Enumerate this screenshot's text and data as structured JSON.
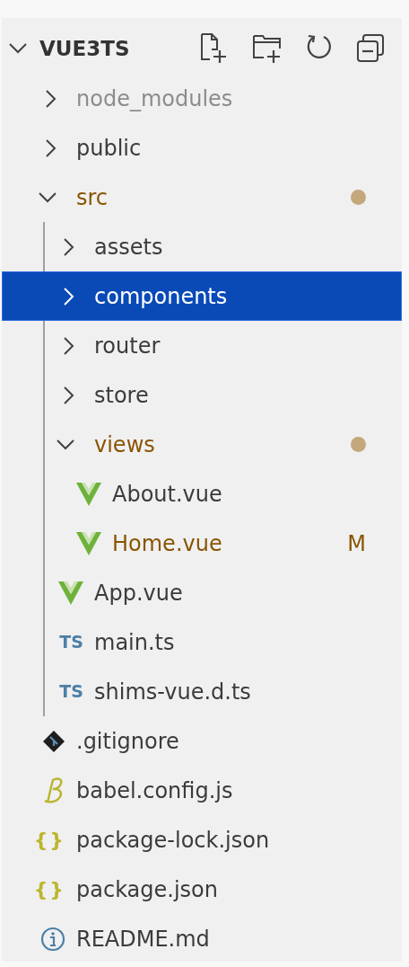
{
  "explorer": {
    "title": "VUE3TS",
    "expanded": true,
    "items": [
      {
        "name": "node_modules",
        "kind": "folder",
        "expanded": false,
        "selected": false,
        "modified": false,
        "ignored": true
      },
      {
        "name": "public",
        "kind": "folder",
        "expanded": false,
        "selected": false,
        "modified": false,
        "ignored": false
      },
      {
        "name": "src",
        "kind": "folder",
        "expanded": true,
        "selected": false,
        "modified": true,
        "ignored": false,
        "indent_guide": true,
        "children": [
          {
            "name": "assets",
            "kind": "folder",
            "expanded": false,
            "selected": false,
            "modified": false,
            "ignored": false
          },
          {
            "name": "components",
            "kind": "folder",
            "expanded": false,
            "selected": true,
            "modified": false,
            "ignored": false
          },
          {
            "name": "router",
            "kind": "folder",
            "expanded": false,
            "selected": false,
            "modified": false,
            "ignored": false
          },
          {
            "name": "store",
            "kind": "folder",
            "expanded": false,
            "selected": false,
            "modified": false,
            "ignored": false
          },
          {
            "name": "views",
            "kind": "folder",
            "expanded": true,
            "selected": false,
            "modified": true,
            "ignored": false,
            "children": [
              {
                "name": "About.vue",
                "kind": "vue",
                "selected": false,
                "modified": false,
                "ignored": false
              },
              {
                "name": "Home.vue",
                "kind": "vue",
                "selected": false,
                "modified": true,
                "ignored": false,
                "badge": "M"
              }
            ]
          },
          {
            "name": "App.vue",
            "kind": "vue",
            "selected": false,
            "modified": false,
            "ignored": false
          },
          {
            "name": "main.ts",
            "kind": "ts",
            "icon_label": "TS",
            "selected": false,
            "modified": false,
            "ignored": false
          },
          {
            "name": "shims-vue.d.ts",
            "kind": "ts",
            "icon_label": "TS",
            "selected": false,
            "modified": false,
            "ignored": false
          }
        ]
      },
      {
        "name": ".gitignore",
        "kind": "git",
        "selected": false,
        "modified": false,
        "ignored": false
      },
      {
        "name": "babel.config.js",
        "kind": "babel",
        "selected": false,
        "modified": false,
        "ignored": false
      },
      {
        "name": "package-lock.json",
        "kind": "json",
        "icon_label": "{}",
        "selected": false,
        "modified": false,
        "ignored": false
      },
      {
        "name": "package.json",
        "kind": "json",
        "icon_label": "{}",
        "selected": false,
        "modified": false,
        "ignored": false
      },
      {
        "name": "README.md",
        "kind": "info",
        "selected": false,
        "modified": false,
        "ignored": false
      }
    ]
  }
}
